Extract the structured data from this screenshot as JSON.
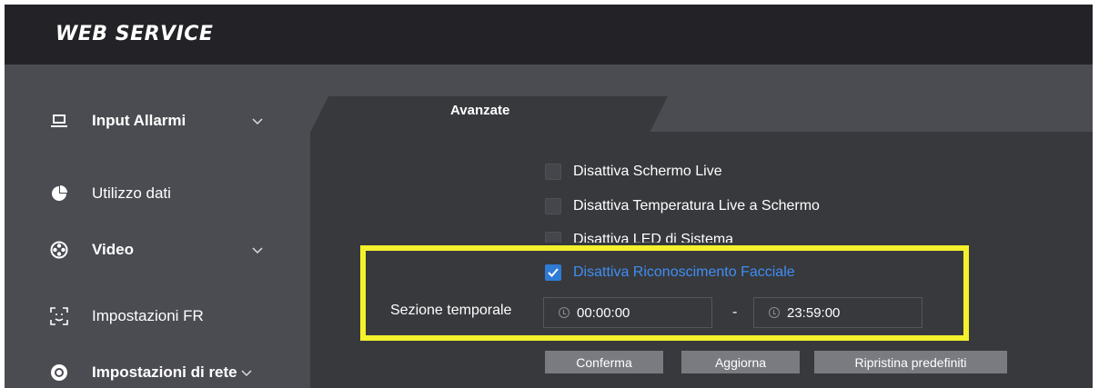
{
  "app": {
    "brand": "WEB SERVICE"
  },
  "sidebar": {
    "items": [
      {
        "label": "Input Allarmi",
        "icon": "monitor-icon",
        "expandable": true,
        "bold": true
      },
      {
        "label": "Utilizzo dati",
        "icon": "pie-chart-icon",
        "expandable": false,
        "bold": false
      },
      {
        "label": "Video",
        "icon": "film-reel-icon",
        "expandable": true,
        "bold": true
      },
      {
        "label": "Impostazioni FR",
        "icon": "face-scan-icon",
        "expandable": false,
        "bold": false
      },
      {
        "label": "Impostazioni di rete",
        "icon": "network-icon",
        "expandable": true,
        "bold": true
      }
    ],
    "chevron": "⌄"
  },
  "tab": {
    "label": "Avanzate"
  },
  "settings": {
    "checkboxes": [
      {
        "label": "Disattiva Schermo Live",
        "checked": false
      },
      {
        "label": "Disattiva Temperatura Live a Schermo",
        "checked": false
      },
      {
        "label": "Disattiva LED di Sistema",
        "checked": false
      },
      {
        "label": "Disattiva Riconoscimento Facciale",
        "checked": true
      }
    ],
    "time_section": {
      "label": "Sezione temporale",
      "start": "00:00:00",
      "separator": "-",
      "end": "23:59:00"
    }
  },
  "buttons": {
    "confirm": "Conferma",
    "refresh": "Aggiorna",
    "reset": "Ripristina predefiniti"
  },
  "colors": {
    "header": "#232327",
    "panel": "#4b4c52",
    "content": "#38393d",
    "accent": "#2f7bd6",
    "highlight": "#f4f12c"
  }
}
